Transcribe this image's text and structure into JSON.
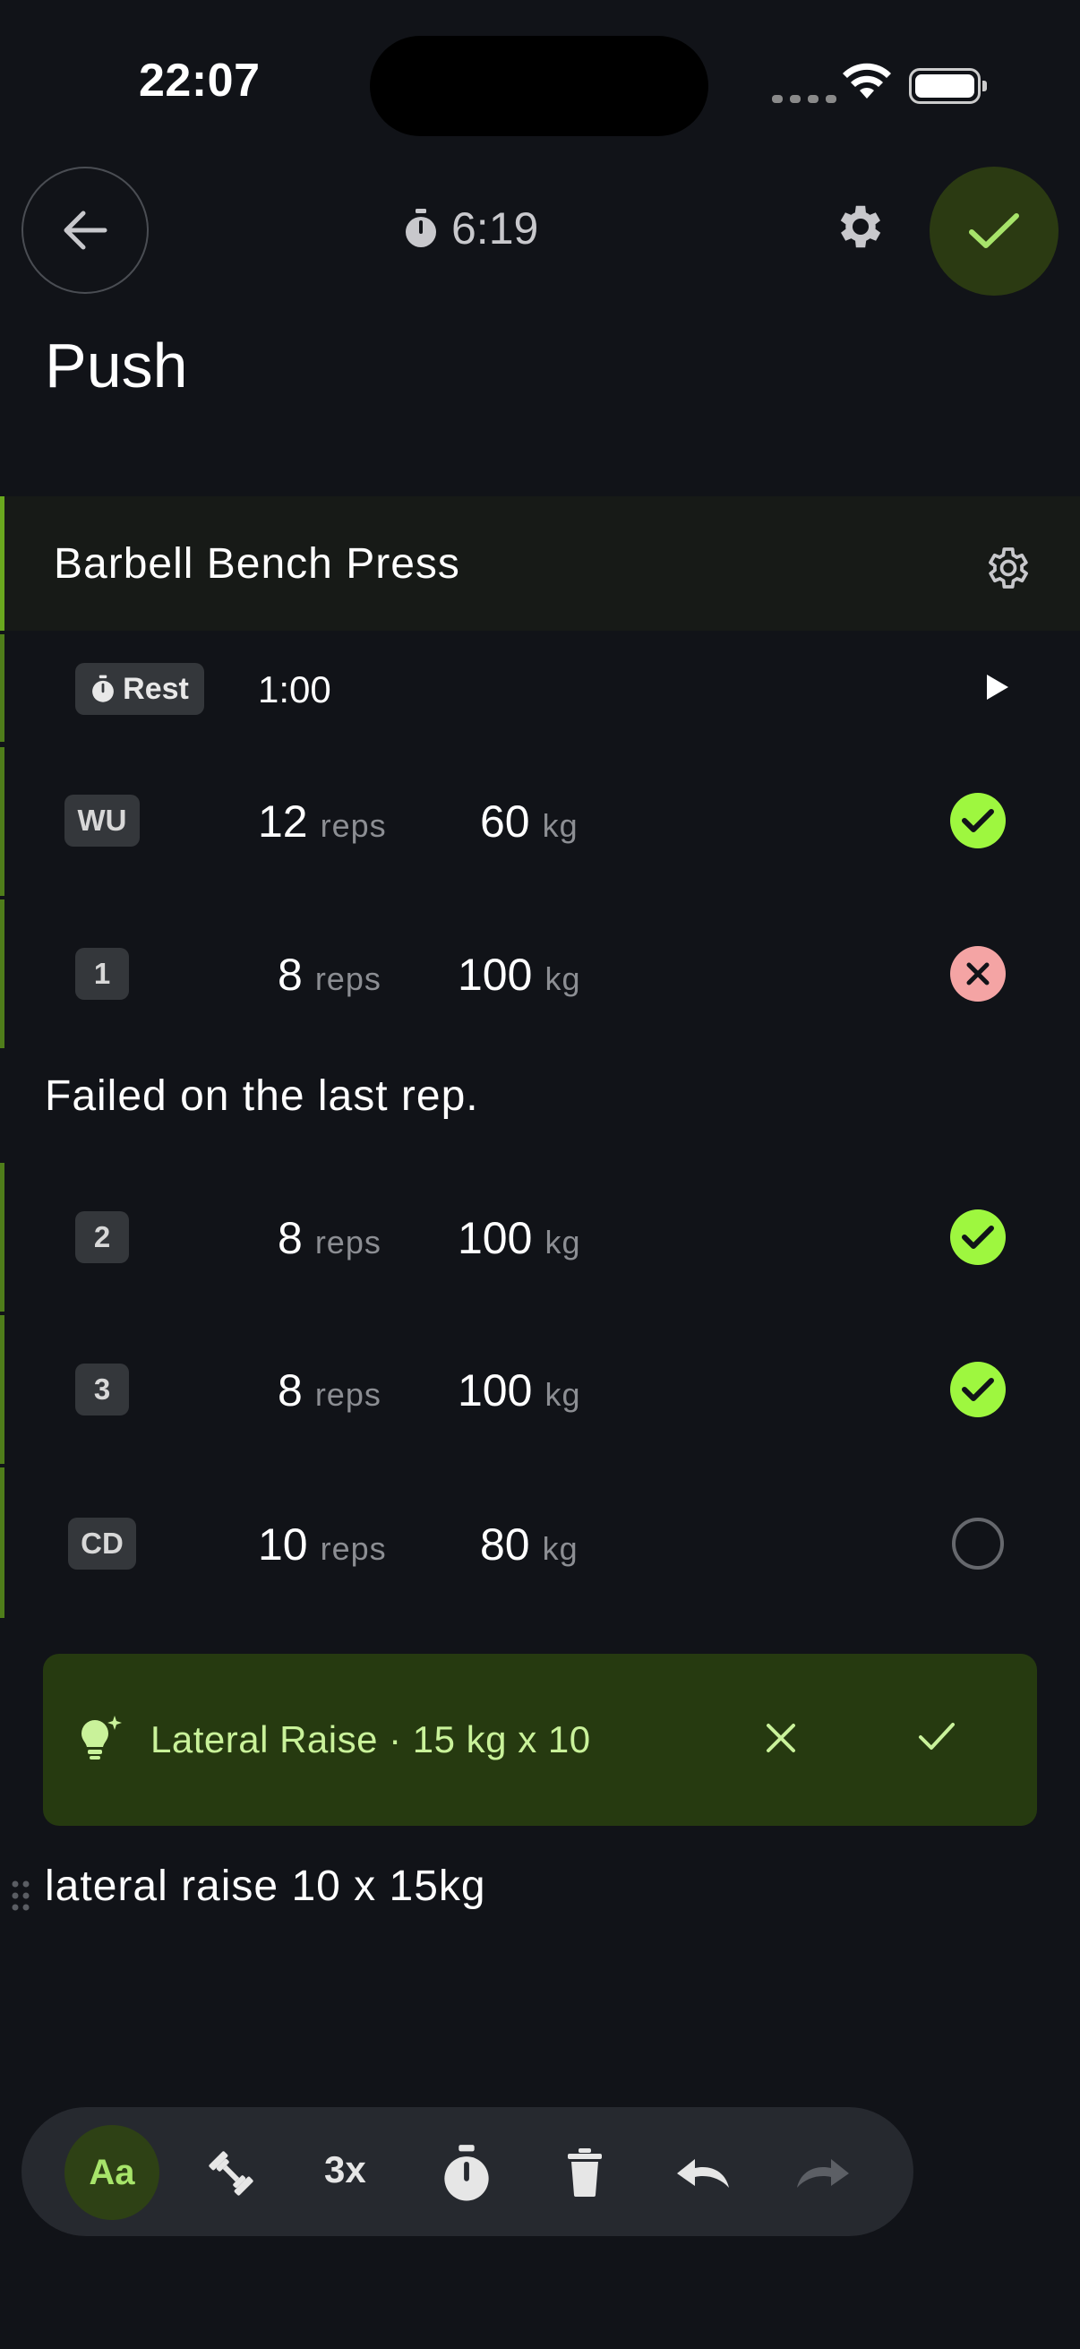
{
  "status_bar": {
    "time": "22:07"
  },
  "header": {
    "elapsed": "6:19"
  },
  "workout": {
    "title": "Push"
  },
  "exercise": {
    "name": "Barbell Bench Press",
    "rest": {
      "label": "Rest",
      "value": "1:00"
    },
    "sets": [
      {
        "badge": "WU",
        "reps": "12",
        "reps_unit": "reps",
        "weight": "60",
        "weight_unit": "kg",
        "status": "done"
      },
      {
        "badge": "1",
        "reps": "8",
        "reps_unit": "reps",
        "weight": "100",
        "weight_unit": "kg",
        "status": "failed"
      },
      {
        "badge": "2",
        "reps": "8",
        "reps_unit": "reps",
        "weight": "100",
        "weight_unit": "kg",
        "status": "done"
      },
      {
        "badge": "3",
        "reps": "8",
        "reps_unit": "reps",
        "weight": "100",
        "weight_unit": "kg",
        "status": "done"
      },
      {
        "badge": "CD",
        "reps": "10",
        "reps_unit": "reps",
        "weight": "80",
        "weight_unit": "kg",
        "status": "pending"
      }
    ],
    "note": "Failed on the last rep."
  },
  "suggestion": {
    "text": "Lateral Raise · 15 kg x 10"
  },
  "editor": {
    "line": "lateral raise 10 x 15kg"
  },
  "toolbar": {
    "text_mode_label": "Aa",
    "multiply_label": "3x"
  },
  "colors": {
    "accent": "#9ef73f",
    "fail": "#f4a4a4",
    "background": "#111318"
  }
}
